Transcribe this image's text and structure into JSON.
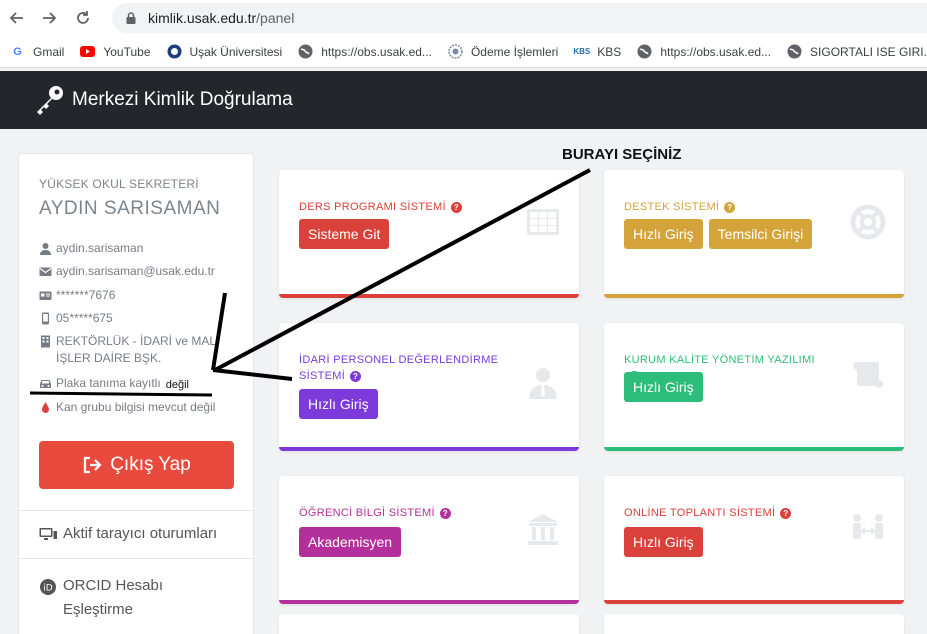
{
  "browser": {
    "url_host": "kimlik.usak.edu.tr",
    "url_path": "/panel",
    "bookmarks": [
      {
        "label": "Gmail",
        "icon": "google-icon"
      },
      {
        "label": "YouTube",
        "icon": "youtube-icon"
      },
      {
        "label": "Uşak Üniversitesi",
        "icon": "university-icon"
      },
      {
        "label": "https://obs.usak.ed...",
        "icon": "globe-icon"
      },
      {
        "label": "Ödeme İşlemleri",
        "icon": "seal-icon"
      },
      {
        "label": "KBS",
        "icon": "kbs-icon"
      },
      {
        "label": "https://obs.usak.ed...",
        "icon": "globe-icon"
      },
      {
        "label": "SIGORTALI ISE GIRI...",
        "icon": "globe-icon"
      }
    ]
  },
  "header": {
    "title": "Merkezi Kimlik Doğrulama"
  },
  "profile": {
    "role": "YÜKSEK OKUL SEKRETERİ",
    "name": "AYDIN SARISAMAN",
    "username": "aydin.sarisaman",
    "email": "aydin.sarisaman@usak.edu.tr",
    "id_masked": "*******7676",
    "phone_masked": "05*****675",
    "unit_line1": "REKTÖRLÜK - İDARİ ve MALİ",
    "unit_line2": "İŞLER DAİRE BŞK.",
    "plate": "Plaka tanıma kayıtlı",
    "plate_annot": "değil",
    "blood": "Kan grubu bilgisi mevcut değil"
  },
  "sidebar": {
    "logout_label": "Çıkış Yap",
    "active_sessions": "Aktif tarayıcı oturumları",
    "orcid_line1": "ORCID Hesabı",
    "orcid_line2": "Eşleştirme"
  },
  "cards": {
    "ders": {
      "title": "DERS PROGRAMI SİSTEMİ",
      "button": "Sisteme Git",
      "color": "#d9413a"
    },
    "destek": {
      "title": "DESTEK SİSTEMİ",
      "button1": "Hızlı Giriş",
      "button2": "Temsilci Girişi",
      "color": "#d4a43a"
    },
    "idari": {
      "title_line1": "İDARİ PERSONEL DEĞERLENDİRME",
      "title_line2": "SİSTEMİ",
      "button": "Hızlı Giriş",
      "color": "#7b3ad9"
    },
    "kalite": {
      "title": "KURUM KALİTE YÖNETİM YAZILIMI",
      "button": "Hızlı Giriş",
      "color": "#2dbd7a"
    },
    "ogrenci": {
      "title": "ÖĞRENCİ BİLGİ SİSTEMİ",
      "button": "Akademisyen",
      "color": "#b3309c"
    },
    "toplanti": {
      "title": "ONLİNE TOPLANTI SİSTEMİ",
      "button": "Hızlı Giriş",
      "color": "#d9413a"
    }
  },
  "annotation": {
    "text": "BURAYI SEÇİNİZ"
  }
}
